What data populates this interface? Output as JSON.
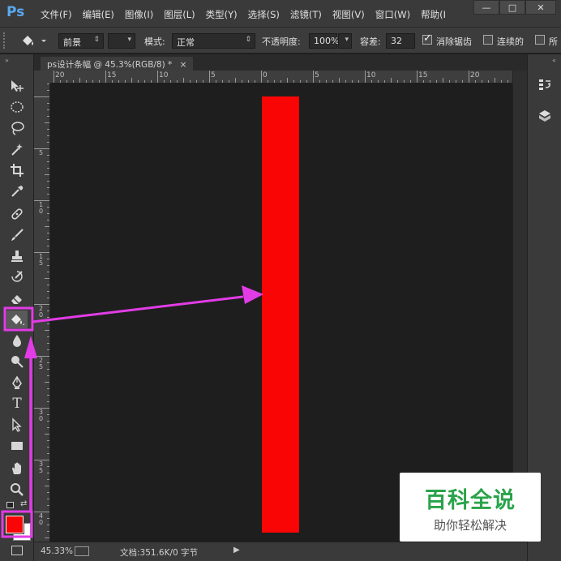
{
  "app": {
    "logo_text": "Ps"
  },
  "menu": {
    "items": [
      "文件(F)",
      "编辑(E)",
      "图像(I)",
      "图层(L)",
      "类型(Y)",
      "选择(S)",
      "滤镜(T)",
      "视图(V)",
      "窗口(W)",
      "帮助(I"
    ]
  },
  "window_controls": {
    "minimize": "—",
    "maximize": "□",
    "close": "✕"
  },
  "options": {
    "fill_source": "前景",
    "mode_label": "模式:",
    "mode_value": "正常",
    "opacity_label": "不透明度:",
    "opacity_value": "100%",
    "tolerance_label": "容差:",
    "tolerance_value": "32",
    "anti_alias_label": "消除锯齿",
    "anti_alias_checked": true,
    "contiguous_label": "连续的",
    "contiguous_checked": false,
    "all_layers_label": "所"
  },
  "document": {
    "tab_title": "ps设计条幅 @ 45.3%(RGB/8) *",
    "tab_close": "×",
    "zoom": "45.33%",
    "doc_info": "文档:351.6K/0 字节",
    "fill_color": "#f90505"
  },
  "rulers": {
    "top_labels": [
      "20",
      "15",
      "10",
      "5",
      "0",
      "5",
      "10",
      "15",
      "20"
    ],
    "left_labels": [
      "5",
      "1\n0",
      "1\n5",
      "2\n0",
      "2\n5",
      "3\n0",
      "3\n5",
      "4\n0"
    ]
  },
  "watermark": {
    "title": "百科全说",
    "subtitle": "助你轻松解决"
  },
  "colors": {
    "foreground": "#f90505",
    "background": "#ffffff",
    "highlight": "#e23ce6",
    "watermark_green": "#2aa34a"
  },
  "tools": [
    "move-tool",
    "marquee-tool",
    "lasso-tool",
    "magic-wand-tool",
    "crop-tool",
    "eyedropper-tool",
    "healing-brush-tool",
    "brush-tool",
    "clone-stamp-tool",
    "history-brush-tool",
    "eraser-tool",
    "paint-bucket-tool",
    "blur-tool",
    "dodge-tool",
    "pen-tool",
    "type-tool",
    "path-selection-tool",
    "rectangle-tool",
    "hand-tool",
    "zoom-tool"
  ]
}
